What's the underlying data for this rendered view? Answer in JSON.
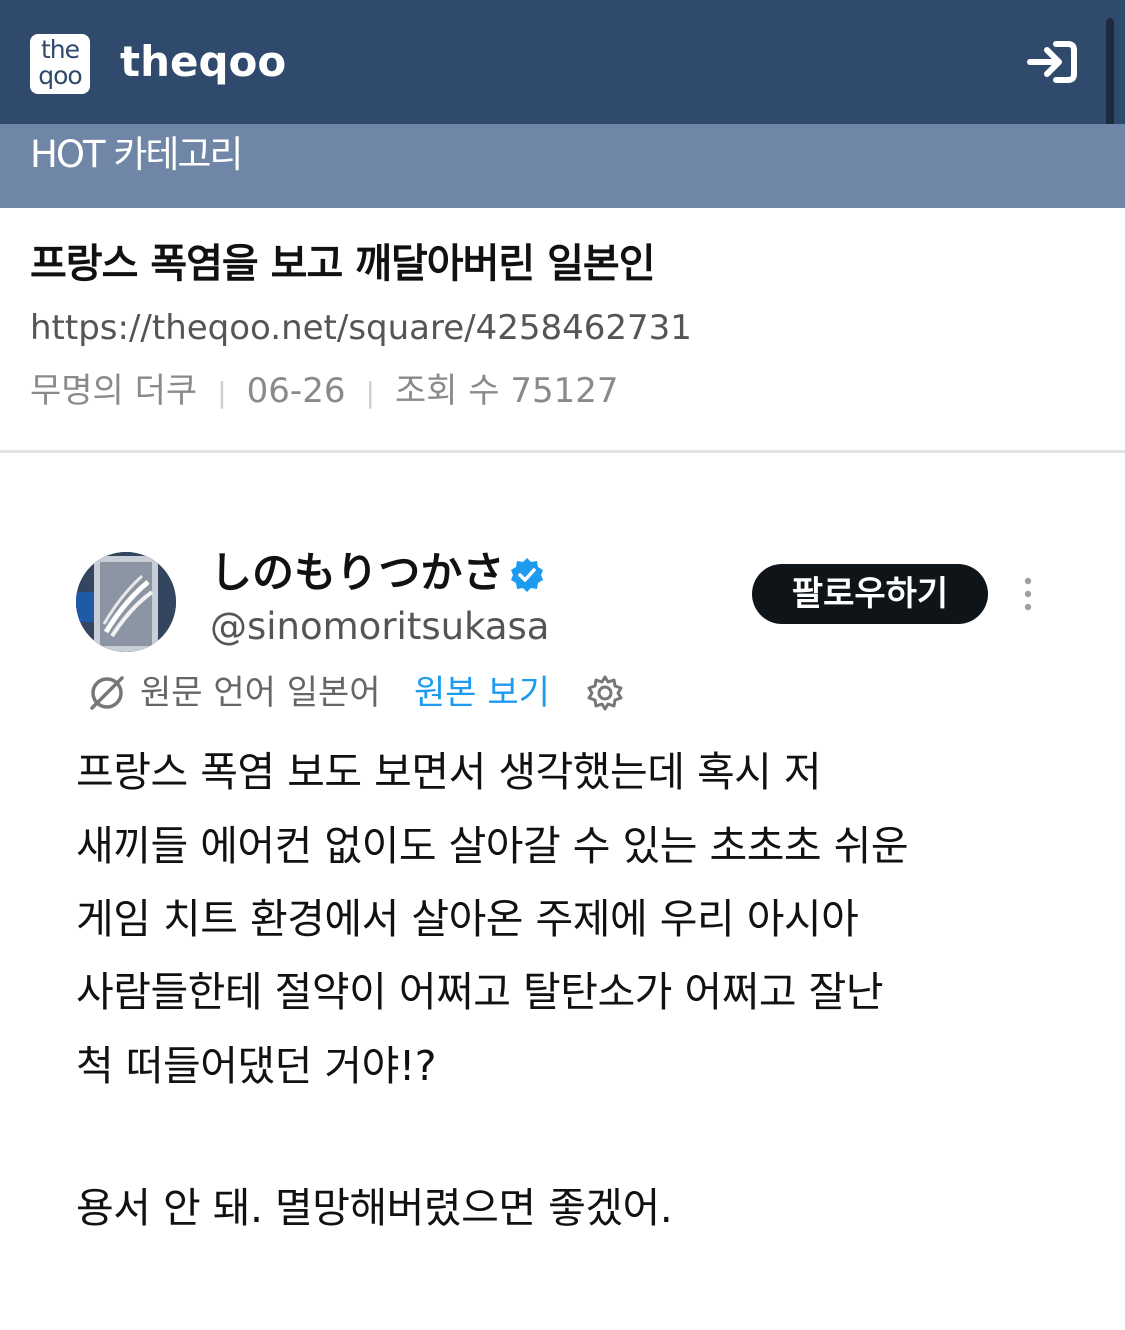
{
  "header": {
    "logo_line1": "the",
    "logo_line2": "qoo",
    "site_name": "theqoo",
    "login_icon": "login-arrow-icon"
  },
  "category_bar": {
    "label": "HOT 카테고리"
  },
  "post": {
    "title": "프랑스 폭염을 보고 깨달아버린 일본인",
    "url": "https://theqoo.net/square/4258462731",
    "author": "무명의 더쿠",
    "date": "06-26",
    "views_label": "조회 수 75127"
  },
  "tweet": {
    "display_name": "しのもりつかさ",
    "handle": "@sinomoritsukasa",
    "verified_icon": "verified-badge-icon",
    "follow_label": "팔로우하기",
    "more_icon": "more-vertical-icon",
    "translation": {
      "icon": "translate-icon",
      "original_language_label": "원문 언어 일본어",
      "view_original_label": "원본 보기",
      "settings_icon": "gear-icon"
    },
    "text_lines": [
      "프랑스 폭염 보도 보면서 생각했는데 혹시 저",
      "새끼들 에어컨 없이도 살아갈 수 있는 초초초 쉬운",
      "게임 치트 환경에서 살아온 주제에 우리 아시아",
      "사람들한테 절약이 어쩌고 탈탄소가 어쩌고 잘난",
      "척 떠들어댔던 거야!?",
      "용서 안 돼. 멸망해버렸으면 좋겠어."
    ]
  },
  "colors": {
    "header_bg": "#2f4a6d",
    "category_bg": "#6f86a6",
    "link_blue": "#1d9bf0",
    "follow_bg": "#0f1419"
  }
}
